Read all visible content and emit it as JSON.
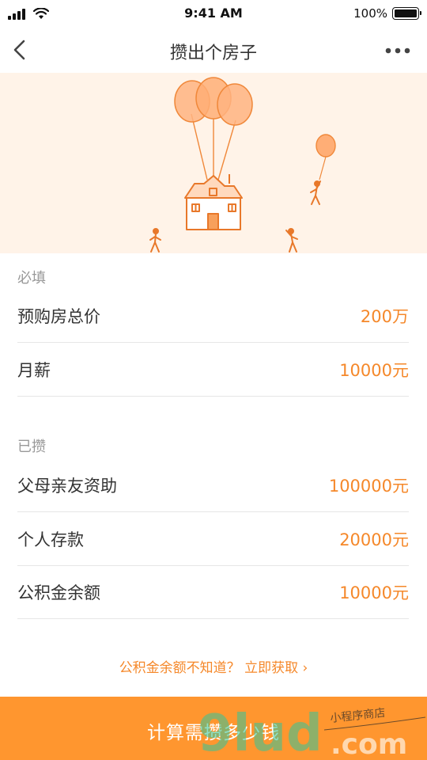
{
  "status_bar": {
    "time": "9:41 AM",
    "battery_text": "100%",
    "battery_level": 1.0
  },
  "nav": {
    "title": "攒出个房子",
    "back_icon": "chevron-left-icon",
    "more_icon": "more-dots-icon"
  },
  "banner": {
    "illustration": "house-with-balloons"
  },
  "sections": {
    "required_label": "必填",
    "saved_label": "已攒"
  },
  "required_rows": [
    {
      "label": "预购房总价",
      "value": "200万"
    },
    {
      "label": "月薪",
      "value": "10000元"
    }
  ],
  "saved_rows": [
    {
      "label": "父母亲友资助",
      "value": "100000元"
    },
    {
      "label": "个人存款",
      "value": "20000元"
    },
    {
      "label": "公积金余额",
      "value": "10000元"
    }
  ],
  "hint_link": "公积金余额不知道？ 立即获取 ›",
  "cta_label": "计算需攒多少钱",
  "watermark": {
    "brand": "9lud",
    "domain": ".com",
    "handwriting": "小程序商店"
  },
  "colors": {
    "accent": "#f5882a",
    "cta_bg": "#ff962f",
    "banner_bg": "#fff3e8"
  }
}
